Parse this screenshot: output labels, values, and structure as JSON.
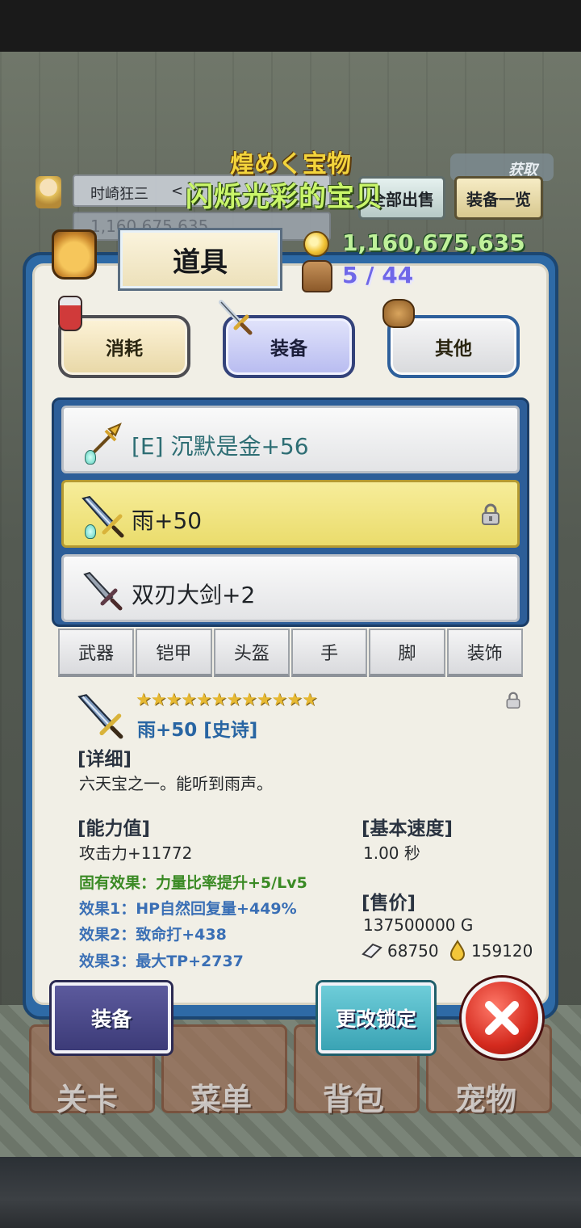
{
  "status": {
    "player_name": "时崎狂三",
    "player_chevron": "<",
    "bg_gold": "1,160,675,635",
    "badge_text": "获取"
  },
  "banner": {
    "jp": "煌めく宝物",
    "cn": "闪烁光彩的宝贝"
  },
  "top_buttons": {
    "sell_all": "全部出售",
    "equip_list": "装备一览"
  },
  "panel": {
    "tab_label": "道具",
    "gold": "1,160,675,635",
    "capacity": "5 / 44"
  },
  "categories": [
    {
      "label": "消耗",
      "icon": "potion-icon"
    },
    {
      "label": "装备",
      "icon": "sword-icon"
    },
    {
      "label": "其他",
      "icon": "sack-icon"
    }
  ],
  "items": [
    {
      "label": "[E] 沉默是金+56",
      "icon": "golden-spear-icon",
      "gem": true,
      "selected": false,
      "locked": false
    },
    {
      "label": "雨+50",
      "icon": "blue-sword-icon",
      "gem": true,
      "selected": true,
      "locked": true
    },
    {
      "label": "双刃大剑+2",
      "icon": "greatsword-icon",
      "gem": false,
      "selected": false,
      "locked": false
    }
  ],
  "subtabs": [
    "武器",
    "铠甲",
    "头盔",
    "手",
    "脚",
    "装饰"
  ],
  "detail": {
    "stars": "★★★★★★★★★★★★",
    "title": "雨+50 [史诗]",
    "detail_header": "[详细]",
    "description": "六天宝之一。能听到雨声。",
    "stats_header": "[能力值]",
    "attack": "攻击力+11772",
    "inherent": "固有效果：力量比率提升+5/Lv5",
    "effect1": "效果1：HP自然回复量+449%",
    "effect2": "效果2：致命打+438",
    "effect3": "效果3：最大TP+2737",
    "speed_header": "[基本速度]",
    "speed": "1.00 秒",
    "price_header": "[售价]",
    "price": "137500000 G",
    "material_count": "68750",
    "drop_count": "159120"
  },
  "bottom_buttons": {
    "equip": "装备",
    "change_lock": "更改锁定"
  },
  "nav": [
    "关卡",
    "菜单",
    "背包",
    "宠物"
  ],
  "colors": {
    "panel_blue": "#2e6aa6",
    "selected_row": "#f2e583",
    "gold_text": "#bff19a",
    "effect_green": "#3a8a24",
    "effect_blue": "#3a6fb5"
  }
}
